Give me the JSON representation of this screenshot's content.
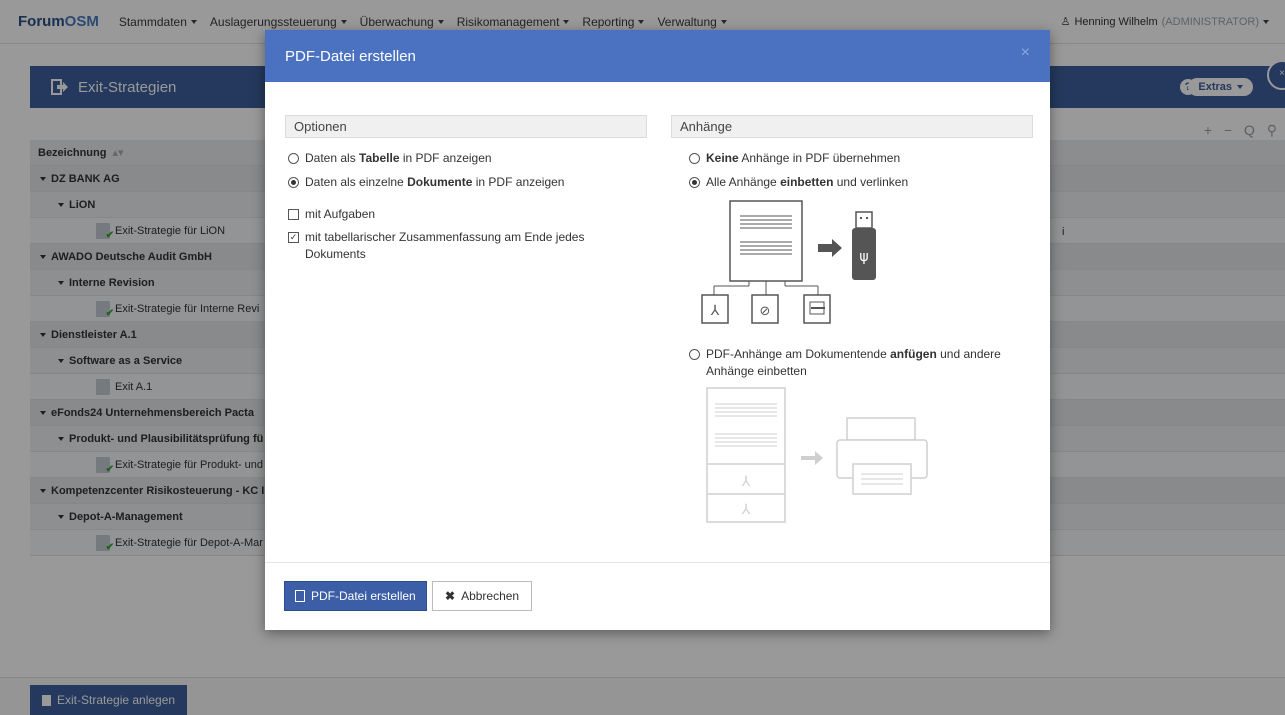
{
  "app": {
    "brand_prefix": "Forum",
    "brand_suffix": "OSM"
  },
  "nav": {
    "items": [
      {
        "label": "Stammdaten"
      },
      {
        "label": "Auslagerungssteuerung"
      },
      {
        "label": "Überwachung"
      },
      {
        "label": "Risikomanagement"
      },
      {
        "label": "Reporting"
      },
      {
        "label": "Verwaltung"
      }
    ],
    "user_name": "Henning Wilhelm",
    "user_role": "(ADMINISTRATOR)"
  },
  "page": {
    "title": "Exit-Strategien",
    "help_label": "?",
    "extras_label": "Extras",
    "close_label": "×",
    "toolbar_icons": "+ − Q ⚲",
    "column_header": "Bezeichnung",
    "stray_text": "i"
  },
  "tree": {
    "rows": [
      {
        "level": 1,
        "label": "DZ BANK AG"
      },
      {
        "level": 2,
        "label": "LiON"
      },
      {
        "level": 3,
        "label": "Exit-Strategie für LiON"
      },
      {
        "level": 1,
        "label": "AWADO Deutsche Audit GmbH"
      },
      {
        "level": 2,
        "label": "Interne Revision"
      },
      {
        "level": 3,
        "label": "Exit-Strategie für Interne Revi"
      },
      {
        "level": 1,
        "label": "Dienstleister A.1"
      },
      {
        "level": 2,
        "label": "Software as a Service"
      },
      {
        "level": 3,
        "label": "Exit A.1"
      },
      {
        "level": 1,
        "label": "eFonds24 Unternehmensbereich Pacta"
      },
      {
        "level": 2,
        "label": "Produkt- und Plausibilitätsprüfung fü"
      },
      {
        "level": 3,
        "label": "Exit-Strategie für Produkt- und"
      },
      {
        "level": 1,
        "label": "Kompetenzcenter Risikosteuerung - KC I"
      },
      {
        "level": 2,
        "label": "Depot-A-Management"
      },
      {
        "level": 3,
        "label": "Exit-Strategie für Depot-A-Mar"
      }
    ]
  },
  "bottom": {
    "create_label": "Exit-Strategie anlegen"
  },
  "modal": {
    "title": "PDF-Datei erstellen",
    "close": "×",
    "options_title": "Optionen",
    "attachments_title": "Anhänge",
    "opt_table": {
      "pre": "Daten als ",
      "bold": "Tabelle",
      "post": " in PDF anzeigen",
      "selected": false
    },
    "opt_docs": {
      "pre": "Daten als einzelne ",
      "bold": "Dokumente",
      "post": " in PDF anzeigen",
      "selected": true
    },
    "chk_tasks": {
      "label": "mit Aufgaben",
      "checked": false
    },
    "chk_summary": {
      "label": "mit tabellarischer Zusammenfassung am Ende jedes Dokuments",
      "checked": true
    },
    "att_none": {
      "bold": "Keine",
      "post": " Anhänge in PDF übernehmen",
      "selected": false
    },
    "att_embed": {
      "pre": "Alle Anhänge ",
      "bold": "einbetten",
      "post": " und verlinken",
      "selected": true
    },
    "att_append": {
      "pre": "PDF-Anhänge am Dokumentende ",
      "bold": "anfügen",
      "post": " und andere Anhänge einbetten",
      "selected": false
    },
    "btn_create": "PDF-Datei erstellen",
    "btn_cancel": "Abbrechen"
  }
}
